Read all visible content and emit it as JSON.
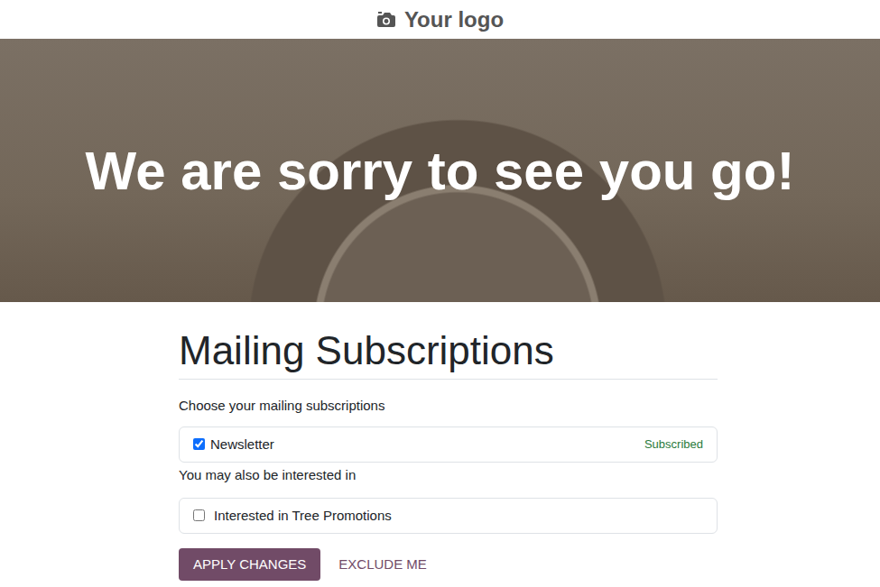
{
  "logo": {
    "text": "Your logo"
  },
  "banner": {
    "title": "We are sorry to see you go!"
  },
  "section": {
    "title": "Mailing Subscriptions",
    "intro": "Choose your mailing subscriptions"
  },
  "subscriptions": [
    {
      "label": "Newsletter",
      "checked": true,
      "status": "Subscribed"
    }
  ],
  "suggestions_heading": "You may also be interested in",
  "suggestions": [
    {
      "label": "Interested in Tree Promotions",
      "checked": false
    }
  ],
  "buttons": [
    {
      "label": "APPLY CHANGES",
      "primary": true
    },
    {
      "label": "EXCLUDE ME",
      "primary": false
    }
  ]
}
